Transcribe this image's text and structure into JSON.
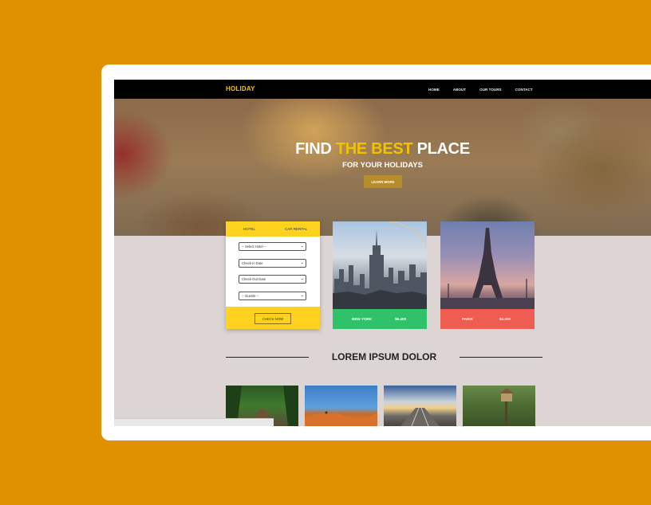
{
  "nav": {
    "logo": "HOLIDAY",
    "items": [
      "HOME",
      "ABOUT",
      "OUR TOURS",
      "CONTACT"
    ]
  },
  "hero": {
    "title_part1": "FIND ",
    "title_accent": "THE BEST",
    "title_part2": " PLACE",
    "subtitle": "FOR YOUR HOLIDAYS",
    "button": "LEARN MORE"
  },
  "booking": {
    "tabs": [
      "HOTEL",
      "CAR RENTAL"
    ],
    "fields": [
      "-- Select Hotel --",
      "Check-in Date",
      "Check-Out Date",
      "-- Guests --"
    ],
    "button": "CHECK NOW"
  },
  "destinations": [
    {
      "city": "NEW YORK",
      "price": "$6.400"
    },
    {
      "city": "PARIS",
      "price": "$4.200"
    }
  ],
  "section": {
    "title": "LOREM IPSUM DOLOR"
  },
  "colors": {
    "background": "#e09100",
    "accent": "#f2c200",
    "booking_yellow": "#ffd21f",
    "new_york_bar": "#2fc26a",
    "paris_bar": "#ef5c52"
  }
}
